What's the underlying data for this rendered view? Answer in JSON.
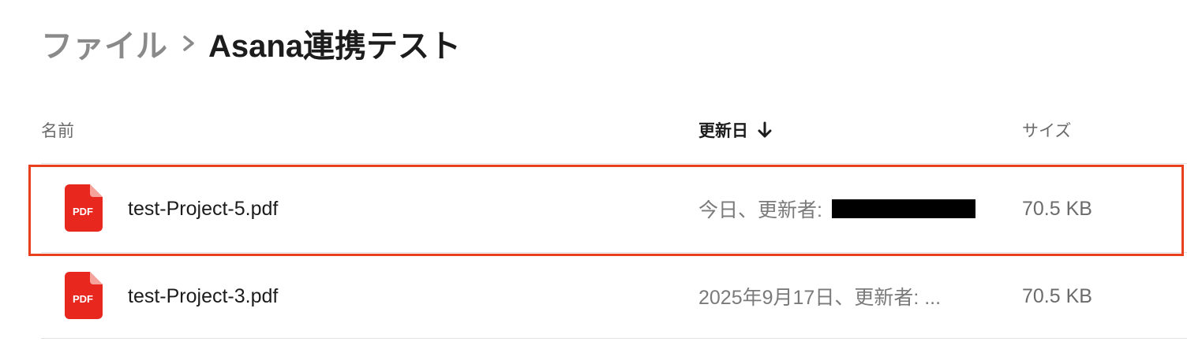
{
  "breadcrumb": {
    "parent": "ファイル",
    "current": "Asana連携テスト"
  },
  "columns": {
    "name": "名前",
    "updated": "更新日",
    "size": "サイズ"
  },
  "files": [
    {
      "name": "test-Project-5.pdf",
      "icon": "pdf-icon",
      "icon_label": "PDF",
      "updated": "今日、更新者: ",
      "updated_by_redacted": true,
      "size": "70.5 KB"
    },
    {
      "name": "test-Project-3.pdf",
      "icon": "pdf-icon",
      "icon_label": "PDF",
      "updated": "2025年9月17日、更新者: ...",
      "updated_by_redacted": false,
      "size": "70.5 KB"
    }
  ],
  "colors": {
    "pdf_red": "#e8271f",
    "highlight": "#e8401c"
  }
}
